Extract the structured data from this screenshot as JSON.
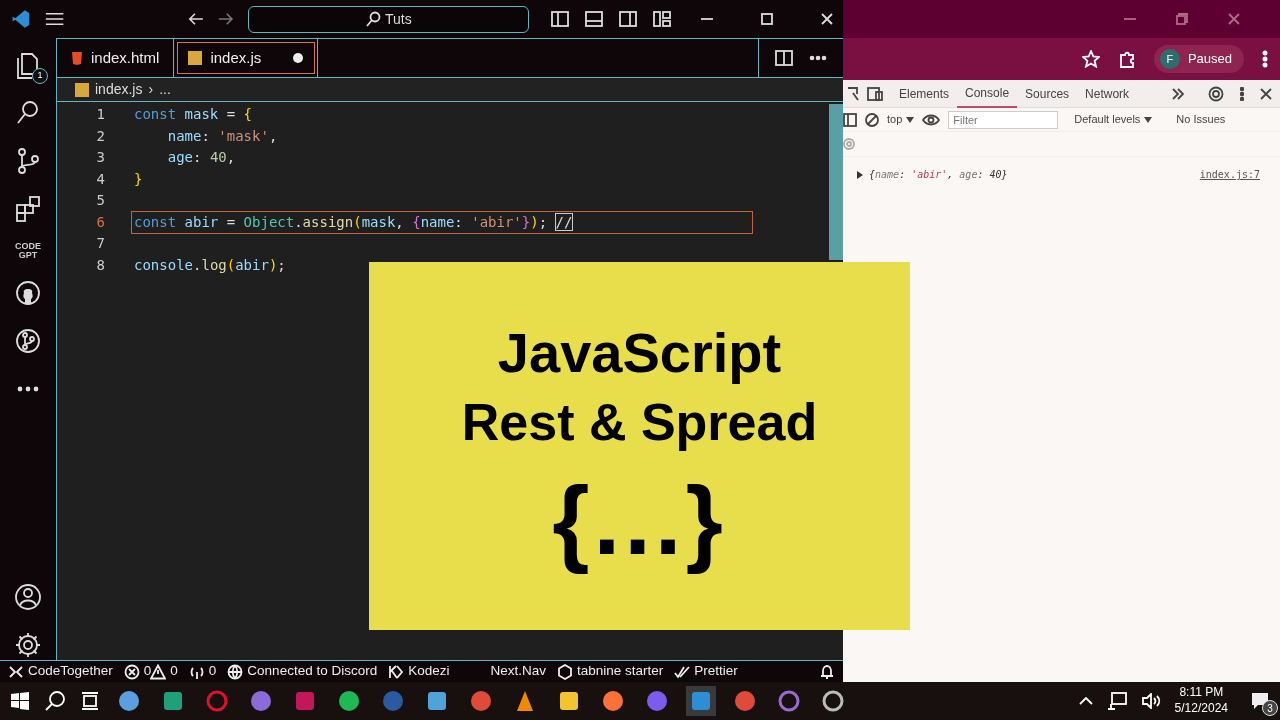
{
  "editor_window": {
    "search": "Tuts",
    "activity_bar": [
      {
        "kind": "files",
        "badge": "1"
      },
      {
        "kind": "search"
      },
      {
        "kind": "branch"
      },
      {
        "kind": "blocks"
      },
      {
        "kind": "codegpt",
        "label": "CODE GPT"
      },
      {
        "kind": "github"
      },
      {
        "kind": "graph"
      },
      {
        "kind": "more"
      },
      {
        "kind": "account"
      },
      {
        "kind": "settings"
      }
    ],
    "tabs": [
      {
        "label": "index.html",
        "kind": "html",
        "selected": false,
        "modified": false
      },
      {
        "label": "index.js",
        "kind": "js",
        "selected": true,
        "modified": true
      }
    ],
    "breadcrumb": [
      "index.js",
      "›",
      "..."
    ],
    "lines": [
      {
        "number": "1",
        "current": false,
        "tokens": [
          {
            "t": "const",
            "kind": "kw"
          },
          {
            "t": " mask ",
            "kind": "var"
          },
          {
            "t": "= ",
            "kind": "op"
          },
          {
            "t": "{",
            "kind": "br"
          }
        ]
      },
      {
        "number": "2",
        "current": false,
        "tokens": [
          {
            "t": "    name",
            "kind": "var"
          },
          {
            "t": ": ",
            "kind": "op"
          },
          {
            "t": "'mask'",
            "kind": "str"
          },
          {
            "t": ",",
            "kind": "op"
          }
        ]
      },
      {
        "number": "3",
        "current": false,
        "tokens": [
          {
            "t": "    age",
            "kind": "var"
          },
          {
            "t": ": ",
            "kind": "op"
          },
          {
            "t": "40",
            "kind": "num"
          },
          {
            "t": ",",
            "kind": "op"
          }
        ]
      },
      {
        "number": "4",
        "current": false,
        "tokens": [
          {
            "t": "}",
            "kind": "br"
          }
        ]
      },
      {
        "number": "5",
        "current": false
      },
      {
        "number": "6",
        "current": true,
        "tokens": [
          {
            "t": "const",
            "kind": "kw"
          },
          {
            "t": " abir ",
            "kind": "var"
          },
          {
            "t": "= ",
            "kind": "op"
          },
          {
            "t": "Object",
            "kind": "cls"
          },
          {
            "t": ".",
            "kind": "op"
          },
          {
            "t": "assign",
            "kind": "fn"
          },
          {
            "t": "(",
            "kind": "br"
          },
          {
            "t": "mask",
            "kind": "var"
          },
          {
            "t": ", ",
            "kind": "op"
          },
          {
            "t": "{",
            "kind": "br2"
          },
          {
            "t": "name",
            "kind": "var"
          },
          {
            "t": ": ",
            "kind": "op"
          },
          {
            "t": "'abir'",
            "kind": "str"
          },
          {
            "t": "}",
            "kind": "br2"
          },
          {
            "t": ")",
            "kind": "br"
          },
          {
            "t": "; ",
            "kind": "op"
          },
          {
            "t": "//",
            "kind": "cmt"
          }
        ]
      },
      {
        "number": "7",
        "current": false
      },
      {
        "number": "8",
        "current": false,
        "tokens": [
          {
            "t": "console",
            "kind": "var"
          },
          {
            "t": ".",
            "kind": "op"
          },
          {
            "t": "log",
            "kind": "fn"
          },
          {
            "t": "(",
            "kind": "br"
          },
          {
            "t": "abir",
            "kind": "var"
          },
          {
            "t": ")",
            "kind": "br"
          },
          {
            "t": ";",
            "kind": "op"
          }
        ]
      }
    ],
    "status_bar": [
      {
        "kind": "remote",
        "text": "CodeTogether"
      },
      {
        "kind": "errors",
        "text": "0"
      },
      {
        "kind": "warnings",
        "text": "0"
      },
      {
        "kind": "ports",
        "text": "0"
      },
      {
        "kind": "globe",
        "text": "Connected to Discord"
      },
      {
        "kind": "kodezi",
        "text": "Kodezi"
      },
      {
        "kind": "plain",
        "text": "Next.Nav"
      },
      {
        "kind": "tabnine",
        "text": "tabnine starter"
      },
      {
        "kind": "check",
        "text": "Prettier"
      },
      {
        "kind": "bell"
      }
    ]
  },
  "browser": {
    "profile_initial": "F",
    "profile_status": "Paused",
    "devtools_tabs": [
      {
        "label": "Elements",
        "selected": false
      },
      {
        "label": "Console",
        "selected": true
      },
      {
        "label": "Sources",
        "selected": false
      },
      {
        "label": "Network",
        "selected": false
      }
    ],
    "context": "top",
    "filter_placeholder": "Filter",
    "levels": "Default levels",
    "issues": "No Issues",
    "log": {
      "parts": [
        {
          "t": "{",
          "kind": "p"
        },
        {
          "t": "name",
          "kind": "key"
        },
        {
          "t": ": ",
          "kind": "p"
        },
        {
          "t": "'abir'",
          "kind": "str"
        },
        {
          "t": ", ",
          "kind": "p"
        },
        {
          "t": "age",
          "kind": "key"
        },
        {
          "t": ": ",
          "kind": "p"
        },
        {
          "t": "40",
          "kind": "num"
        },
        {
          "t": "}",
          "kind": "p"
        }
      ],
      "source": "index.js:7"
    }
  },
  "overlay": {
    "lines": [
      "JavaScript",
      "Rest & Spread",
      "{...}"
    ]
  },
  "taskbar": {
    "time": "8:11 PM",
    "date": "5/12/2024",
    "notifications": "3"
  }
}
